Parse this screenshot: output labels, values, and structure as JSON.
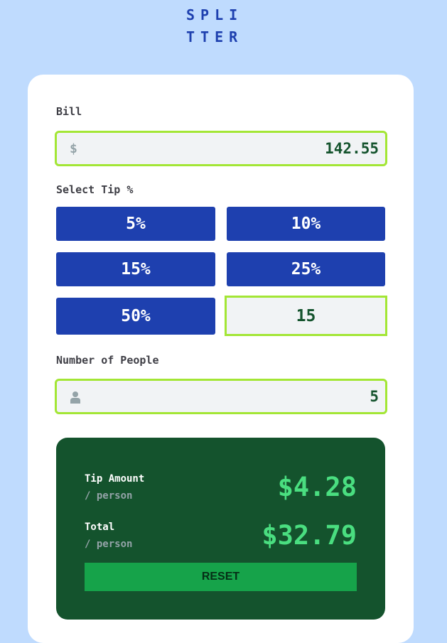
{
  "logo": {
    "line1": "SPLI",
    "line2": "TTER"
  },
  "bill": {
    "label": "Bill",
    "currency_symbol": "$",
    "value": "142.55"
  },
  "tip": {
    "label": "Select Tip %",
    "options": [
      "5%",
      "10%",
      "15%",
      "25%",
      "50%"
    ],
    "custom_value": "15"
  },
  "people": {
    "label": "Number of People",
    "icon": "person-icon",
    "value": "5"
  },
  "result": {
    "tip_label": "Tip Amount",
    "tip_sub": "/ person",
    "tip_amount": "$4.28",
    "total_label": "Total",
    "total_sub": "/ person",
    "total_amount": "$32.79",
    "reset_label": "RESET"
  },
  "colors": {
    "background": "#bfdbfe",
    "primary": "#1e40af",
    "accent": "#a3e635",
    "result_bg": "#14532d",
    "amount": "#4ade80",
    "reset_bg": "#16a34a"
  }
}
